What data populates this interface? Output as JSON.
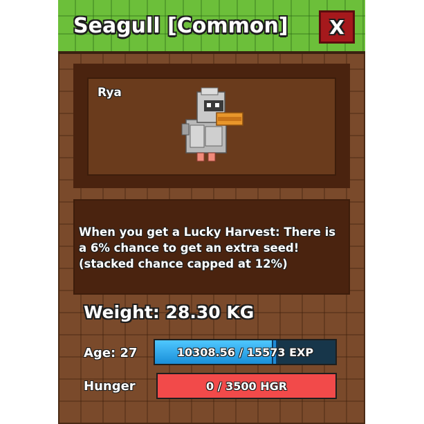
{
  "header": {
    "title": "Seagull [Common]",
    "close_label": "X"
  },
  "pet": {
    "name": "Rya",
    "icon": "seagull-pet-icon"
  },
  "description": "When you get a Lucky Harvest: There is\na 6% chance to get an extra seed!\n(stacked chance capped at 12%)",
  "stats": {
    "weight": "Weight: 28.30 KG",
    "age_label": "Age: 27",
    "hunger_label": "Hunger",
    "exp": {
      "current": 10308.56,
      "max": 15573,
      "text": "10308.56 / 15573 EXP"
    },
    "hunger": {
      "current": 0,
      "max": 3500,
      "text": "0 / 3500 HGR"
    }
  },
  "colors": {
    "header_green": "#6cbf3a",
    "panel_brown": "#7a4a2b",
    "close_red": "#a5191c",
    "exp_blue": "#1a8fd8",
    "hunger_red": "#f24a4a"
  }
}
